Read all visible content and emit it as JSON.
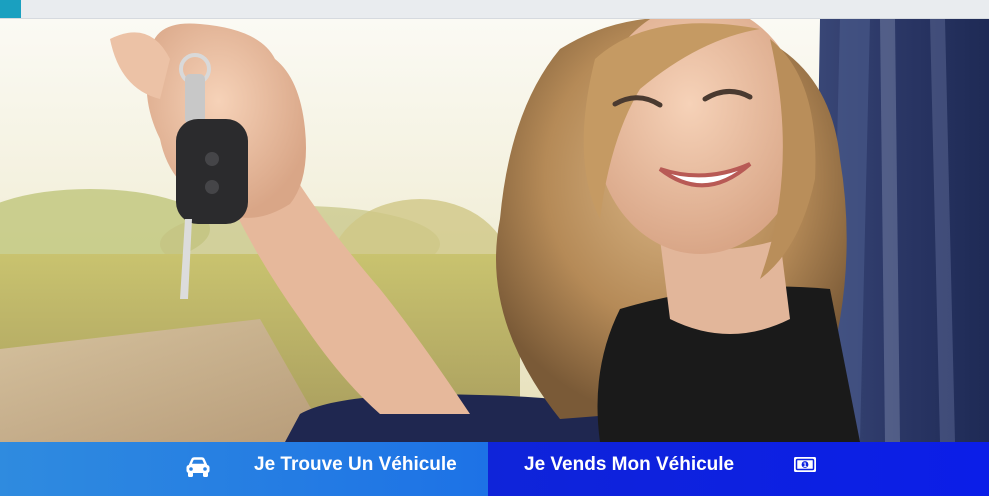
{
  "cta": {
    "find_vehicle_label": "Je Trouve Un Véhicule",
    "sell_vehicle_label": "Je Vends Mon Véhicule",
    "find_icon": "car-icon",
    "sell_icon": "banknote-icon"
  },
  "colors": {
    "find_bg": "#2a82e2",
    "sell_bg": "#0d22e0",
    "topbar_accent": "#1aa0c0",
    "topbar_bg": "#e9ecef"
  },
  "hero": {
    "image": "woman-holding-car-keys-photo"
  }
}
